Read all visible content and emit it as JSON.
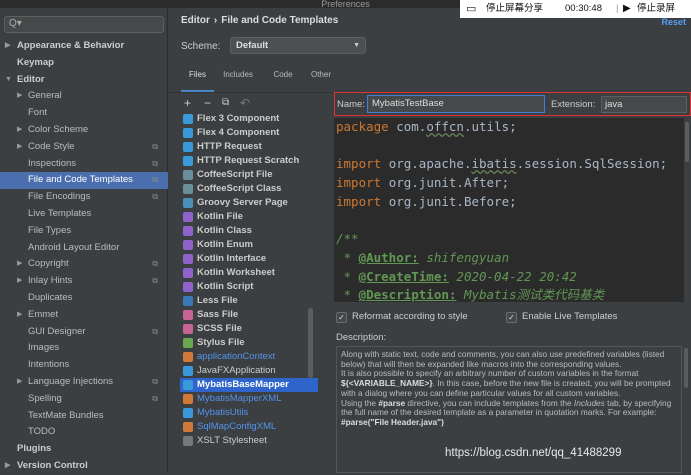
{
  "window": {
    "title": "Preferences"
  },
  "search": {
    "placeholder": "Q▾"
  },
  "sidebar": {
    "items": [
      {
        "label": "Appearance & Behavior",
        "level": 0,
        "arrow": "▶",
        "bold": true
      },
      {
        "label": "Keymap",
        "level": 0,
        "bold": true
      },
      {
        "label": "Editor",
        "level": 0,
        "arrow": "▼",
        "bold": true
      },
      {
        "label": "General",
        "level": 1,
        "arrow": "▶"
      },
      {
        "label": "Font",
        "level": 1
      },
      {
        "label": "Color Scheme",
        "level": 1,
        "arrow": "▶"
      },
      {
        "label": "Code Style",
        "level": 1,
        "arrow": "▶",
        "copy": true
      },
      {
        "label": "Inspections",
        "level": 1,
        "copy": true
      },
      {
        "label": "File and Code Templates",
        "level": 1,
        "copy": true,
        "selected": true
      },
      {
        "label": "File Encodings",
        "level": 1,
        "copy": true
      },
      {
        "label": "Live Templates",
        "level": 1
      },
      {
        "label": "File Types",
        "level": 1
      },
      {
        "label": "Android Layout Editor",
        "level": 1
      },
      {
        "label": "Copyright",
        "level": 1,
        "arrow": "▶",
        "copy": true
      },
      {
        "label": "Inlay Hints",
        "level": 1,
        "arrow": "▶",
        "copy": true
      },
      {
        "label": "Duplicates",
        "level": 1
      },
      {
        "label": "Emmet",
        "level": 1,
        "arrow": "▶"
      },
      {
        "label": "GUI Designer",
        "level": 1,
        "copy": true
      },
      {
        "label": "Images",
        "level": 1
      },
      {
        "label": "Intentions",
        "level": 1
      },
      {
        "label": "Language Injections",
        "level": 1,
        "arrow": "▶",
        "copy": true
      },
      {
        "label": "Spelling",
        "level": 1,
        "copy": true
      },
      {
        "label": "TextMate Bundles",
        "level": 1
      },
      {
        "label": "TODO",
        "level": 1
      },
      {
        "label": "Plugins",
        "level": 0,
        "bold": true
      },
      {
        "label": "Version Control",
        "level": 0,
        "arrow": "▶",
        "bold": true
      }
    ]
  },
  "header": {
    "crumb_parent": "Editor",
    "crumb_sep": "›",
    "crumb_current": "File and Code Templates",
    "reset": "Reset"
  },
  "scheme": {
    "label": "Scheme:",
    "value": "Default"
  },
  "tabs": [
    "Files",
    "Includes",
    "Code",
    "Other"
  ],
  "toolbar": {
    "add": "+",
    "remove": "−",
    "copy": "⧉",
    "reset": "↶"
  },
  "files": [
    {
      "label": "Flex 3 Component",
      "icon": "flex",
      "color": "#3a9ad9"
    },
    {
      "label": "Flex 4 Component",
      "icon": "flex",
      "color": "#3a9ad9"
    },
    {
      "label": "HTTP Request",
      "icon": "http",
      "color": "#3a9ad9"
    },
    {
      "label": "HTTP Request Scratch",
      "icon": "http",
      "color": "#3a9ad9"
    },
    {
      "label": "CoffeeScript File",
      "icon": "coffee",
      "color": "#6b8e9b"
    },
    {
      "label": "CoffeeScript Class",
      "icon": "coffee",
      "color": "#6b8e9b"
    },
    {
      "label": "Groovy Server Page",
      "icon": "groovy",
      "color": "#4a90b8"
    },
    {
      "label": "Kotlin File",
      "icon": "kotlin",
      "color": "#8f63c7"
    },
    {
      "label": "Kotlin Class",
      "icon": "kotlin",
      "color": "#8f63c7"
    },
    {
      "label": "Kotlin Enum",
      "icon": "kotlin",
      "color": "#8f63c7"
    },
    {
      "label": "Kotlin Interface",
      "icon": "kotlin",
      "color": "#8f63c7"
    },
    {
      "label": "Kotlin Worksheet",
      "icon": "kotlin",
      "color": "#8f63c7"
    },
    {
      "label": "Kotlin Script",
      "icon": "kotlin",
      "color": "#8f63c7"
    },
    {
      "label": "Less File",
      "icon": "less",
      "color": "#3a78b8"
    },
    {
      "label": "Sass File",
      "icon": "sass",
      "color": "#c76494"
    },
    {
      "label": "SCSS File",
      "icon": "scss",
      "color": "#c76494"
    },
    {
      "label": "Stylus File",
      "icon": "stylus",
      "color": "#6aa84f"
    },
    {
      "label": "applicationContext",
      "icon": "xml",
      "color": "#d07a3a",
      "style": "blue"
    },
    {
      "label": "JavaFXApplication",
      "icon": "java",
      "color": "#3a9ad9",
      "style": "plain"
    },
    {
      "label": "MybatisBaseMapper",
      "icon": "java",
      "color": "#3a9ad9",
      "style": "sel"
    },
    {
      "label": "MybatisMapperXML",
      "icon": "xml",
      "color": "#d07a3a",
      "style": "blue"
    },
    {
      "label": "MybatisUtils",
      "icon": "java",
      "color": "#3a9ad9",
      "style": "blue"
    },
    {
      "label": "SqlMapConfigXML",
      "icon": "xml",
      "color": "#d07a3a",
      "style": "blue"
    },
    {
      "label": "XSLT Stylesheet",
      "icon": "xslt",
      "color": "#777777",
      "style": "plain"
    }
  ],
  "editor": {
    "name_label": "Name:",
    "name_value": "MybatisTestBase",
    "ext_label": "Extension:",
    "ext_value": "java",
    "code": {
      "l1_kw": "package ",
      "l1_txt": "com.",
      "l1_w": "offcn",
      "l1_end": ".utils;",
      "l3_kw": "import ",
      "l3_a": "org.apache.",
      "l3_w": "ibatis",
      "l3_b": ".session.SqlSession;",
      "l4_kw": "import ",
      "l4_txt": "org.junit.After;",
      "l5_kw": "import ",
      "l5_txt": "org.junit.Before;",
      "l7": "/**",
      "l8_star": " * ",
      "l8_tag": "@Author:",
      "l8_val": " shifengyuan",
      "l9_star": " * ",
      "l9_tag": "@CreateTime:",
      "l9_val": " 2020-04-22 20:42",
      "l10_star": " * ",
      "l10_tag": "@Description:",
      "l10_val": " Mybatis测试类代码基类"
    },
    "reformat": "Reformat according to style",
    "live": "Enable Live Templates",
    "desc_label": "Description:",
    "desc": {
      "p1": "Along with static text, code and comments, you can also use predefined variables (listed below) that will then be expanded like macros into the corresponding values.",
      "p2a": "It is also possible to specify an arbitrary number of custom variables in the format ",
      "p2b": "${<VARIABLE_NAME>}",
      "p2c": ". In this case, before the new file is created, you will be prompted with a dialog where you can define particular values for all custom variables.",
      "p3a": "Using the ",
      "p3b": "#parse",
      "p3c": " directive, you can include templates from the ",
      "p3d": "Includes",
      "p3e": " tab, by specifying the full name of the desired template as a parameter in quotation marks. For example:",
      "p4": "#parse(\"File Header.java\")"
    }
  },
  "overlay": {
    "share": "停止屏幕分享",
    "time": "00:30:48",
    "record": "停止录屏"
  },
  "watermark": "https://blog.csdn.net/qq_41488299"
}
